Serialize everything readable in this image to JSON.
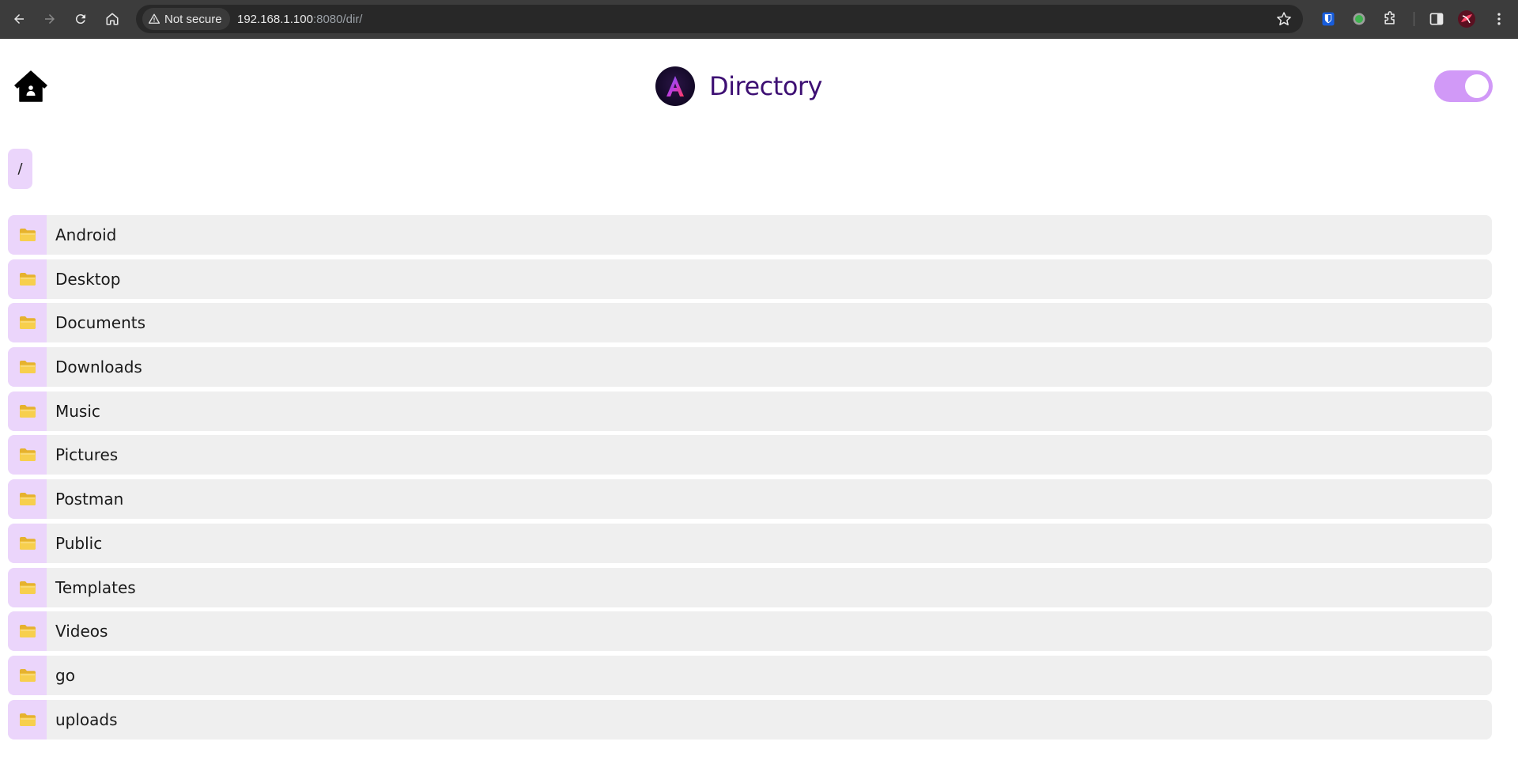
{
  "browser": {
    "security_label": "Not secure",
    "url_host": "192.168.1.100",
    "url_rest": ":8080/dir/",
    "icons": [
      "back-icon",
      "forward-icon",
      "reload-icon",
      "home-icon",
      "warning-icon",
      "star-icon",
      "bitwarden-icon",
      "extension-circle-icon",
      "puzzle-icon",
      "side-panel-icon",
      "profile-avatar-icon",
      "kebab-menu-icon"
    ]
  },
  "header": {
    "title": "Directory",
    "logo_letter": "A",
    "theme_toggle_on": true,
    "accent_color": "#d199f7",
    "title_color": "#3d0f73"
  },
  "breadcrumb": {
    "path": "/"
  },
  "directory": {
    "items": [
      {
        "name": "Android",
        "icon": "folder-icon"
      },
      {
        "name": "Desktop",
        "icon": "folder-icon"
      },
      {
        "name": "Documents",
        "icon": "folder-icon"
      },
      {
        "name": "Downloads",
        "icon": "folder-icon"
      },
      {
        "name": "Music",
        "icon": "folder-icon"
      },
      {
        "name": "Pictures",
        "icon": "folder-icon"
      },
      {
        "name": "Postman",
        "icon": "folder-icon"
      },
      {
        "name": "Public",
        "icon": "folder-icon"
      },
      {
        "name": "Templates",
        "icon": "folder-icon"
      },
      {
        "name": "Videos",
        "icon": "folder-icon"
      },
      {
        "name": "go",
        "icon": "folder-icon"
      },
      {
        "name": "uploads",
        "icon": "folder-icon"
      }
    ]
  }
}
